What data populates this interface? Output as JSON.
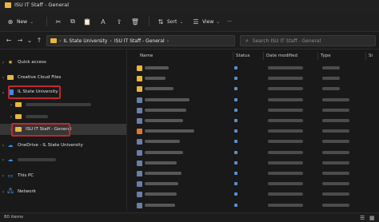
{
  "window": {
    "title": "ISU IT Staff - General"
  },
  "toolbar": {
    "new_label": "New",
    "sort_label": "Sort",
    "view_label": "View",
    "more_label": "···"
  },
  "address": {
    "crumbs": [
      "IL State University",
      "ISU IT Staff - General"
    ],
    "search_placeholder": "Search ISU IT Staff - General"
  },
  "sidebar": {
    "quick_access": "Quick access",
    "creative_cloud": "Creative Cloud Files",
    "il_state": "IL State University",
    "isu_general": "ISU IT Staff - General",
    "onedrive_il": "OneDrive - IL State University",
    "this_pc": "This PC",
    "network": "Network"
  },
  "columns": {
    "name": "Name",
    "status": "Status",
    "date_modified": "Date modified",
    "type": "Type",
    "size": "Si"
  },
  "status_bar": {
    "items": "80 items"
  },
  "colors": {
    "accent_red": "#c0282d",
    "folder": "#e8b740",
    "cloud": "#3a8ee6"
  }
}
